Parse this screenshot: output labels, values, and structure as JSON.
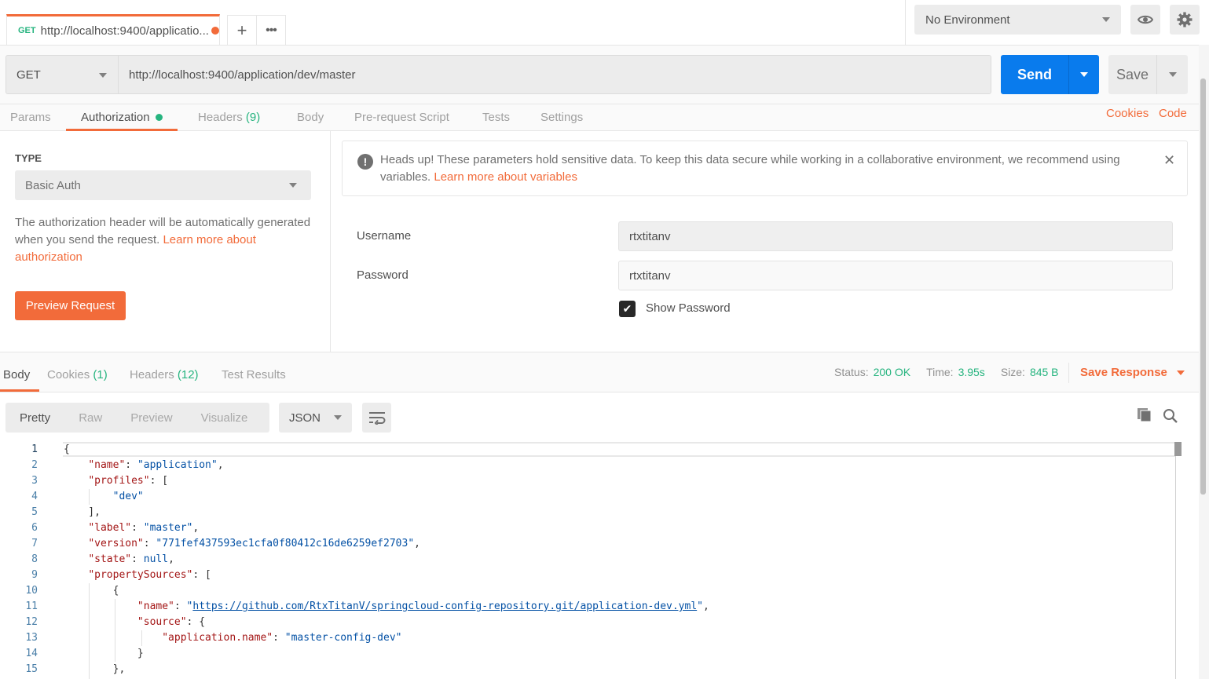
{
  "tab": {
    "method": "GET",
    "title": "http://localhost:9400/applicatio...",
    "unsaved": true,
    "new_tab_label": "+",
    "more_label": "•••"
  },
  "environment": {
    "selected": "No Environment",
    "eye_icon": "eye-icon",
    "gear_icon": "gear-icon"
  },
  "request": {
    "method": "GET",
    "url": "http://localhost:9400/application/dev/master",
    "send_label": "Send",
    "save_label": "Save"
  },
  "request_tabs": [
    {
      "label": "Params",
      "count": ""
    },
    {
      "label": "Authorization",
      "count": "",
      "active": true,
      "indicator": true
    },
    {
      "label": "Headers",
      "count": "(9)"
    },
    {
      "label": "Body",
      "count": ""
    },
    {
      "label": "Pre-request Script",
      "count": ""
    },
    {
      "label": "Tests",
      "count": ""
    },
    {
      "label": "Settings",
      "count": ""
    }
  ],
  "links": {
    "cookies": "Cookies",
    "code": "Code"
  },
  "auth": {
    "type_label": "TYPE",
    "type_value": "Basic Auth",
    "description": "The authorization header will be automatically generated when you send the request. ",
    "description_link": "Learn more about authorization",
    "preview_button": "Preview Request",
    "warning_text": "Heads up! These parameters hold sensitive data. To keep this data secure while working in a collaborative environment, we recommend using variables. ",
    "warning_link": "Learn more about variables",
    "close_label": "✕",
    "username_label": "Username",
    "username_value": "rtxtitanv",
    "password_label": "Password",
    "password_value": "rtxtitanv",
    "show_password_label": "Show Password",
    "show_password_checked": true
  },
  "response": {
    "tabs": [
      {
        "label": "Body",
        "count": "",
        "active": true
      },
      {
        "label": "Cookies",
        "count": "(1)"
      },
      {
        "label": "Headers",
        "count": "(12)"
      },
      {
        "label": "Test Results",
        "count": ""
      }
    ],
    "status_label": "Status:",
    "status_value": "200 OK",
    "time_label": "Time:",
    "time_value": "3.95s",
    "size_label": "Size:",
    "size_value": "845 B",
    "save_response": "Save Response",
    "view_modes": [
      "Pretty",
      "Raw",
      "Preview",
      "Visualize"
    ],
    "active_view": "Pretty",
    "format": "JSON"
  },
  "code_lines": [
    {
      "n": "1",
      "t": "{"
    },
    {
      "n": "2",
      "t": "    \"name\": \"application\","
    },
    {
      "n": "3",
      "t": "    \"profiles\": ["
    },
    {
      "n": "4",
      "t": "        \"dev\""
    },
    {
      "n": "5",
      "t": "    ],"
    },
    {
      "n": "6",
      "t": "    \"label\": \"master\","
    },
    {
      "n": "7",
      "t": "    \"version\": \"771fef437593ec1cfa0f80412c16de6259ef2703\","
    },
    {
      "n": "8",
      "t": "    \"state\": null,"
    },
    {
      "n": "9",
      "t": "    \"propertySources\": ["
    },
    {
      "n": "10",
      "t": "        {"
    },
    {
      "n": "11",
      "t": "            \"name\": \"https://github.com/RtxTitanV/springcloud-config-repository.git/application-dev.yml\","
    },
    {
      "n": "12",
      "t": "            \"source\": {"
    },
    {
      "n": "13",
      "t": "                \"application.name\": \"master-config-dev\""
    },
    {
      "n": "14",
      "t": "            }"
    },
    {
      "n": "15",
      "t": "        },"
    }
  ],
  "colors": {
    "accent": "#f26b3a",
    "send": "#097bed",
    "success": "#26b47f",
    "json_key": "#a31515",
    "json_string": "#0451a5"
  }
}
